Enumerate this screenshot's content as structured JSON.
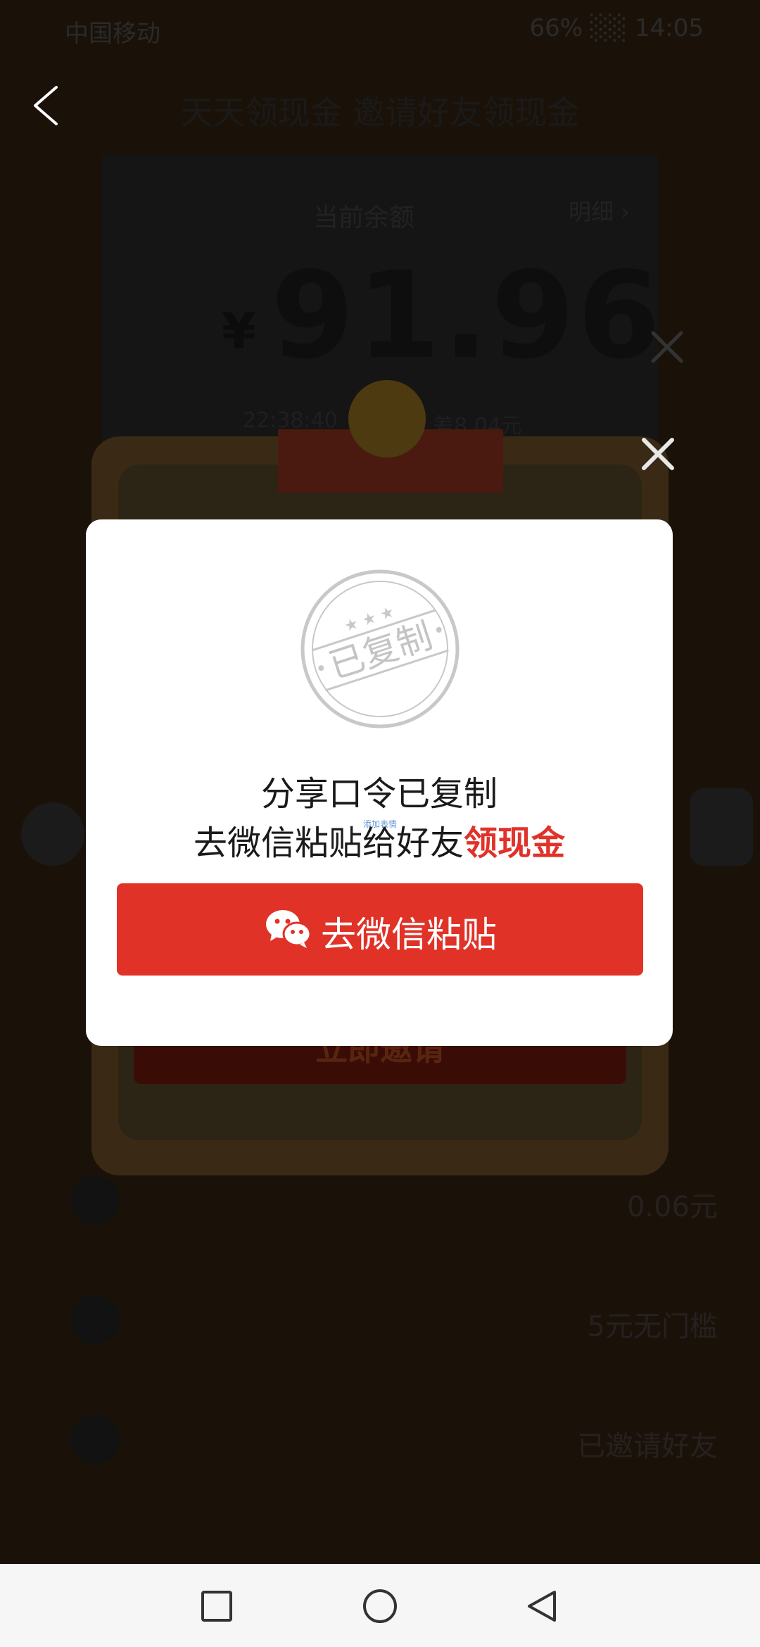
{
  "status_bar": {
    "carrier": "中国移动",
    "right": "66% ░░ 14:05"
  },
  "header": {
    "title": "天天领现金 邀请好友领现金"
  },
  "balance": {
    "label": "当前余额",
    "detail": "明细 ›",
    "currency": "¥",
    "amount": "91.96",
    "sub_left": "22:38:40",
    "sub_right": "差8.04元"
  },
  "background": {
    "invite_button": "立即邀请",
    "rows": [
      {
        "text": "0.06元"
      },
      {
        "text": "5元无门槛"
      },
      {
        "text": "已邀请好友"
      }
    ]
  },
  "dialog": {
    "stamp_text": "已复制",
    "line1": "分享口令已复制",
    "line2_prefix": "去微信粘贴给好友",
    "line2_highlight": "领现金",
    "tiny_tag": "添加表情",
    "button_label": "去微信粘贴"
  },
  "colors": {
    "accent": "#e13228",
    "highlight": "#e0322a",
    "dialog_bg": "#ffffff"
  }
}
